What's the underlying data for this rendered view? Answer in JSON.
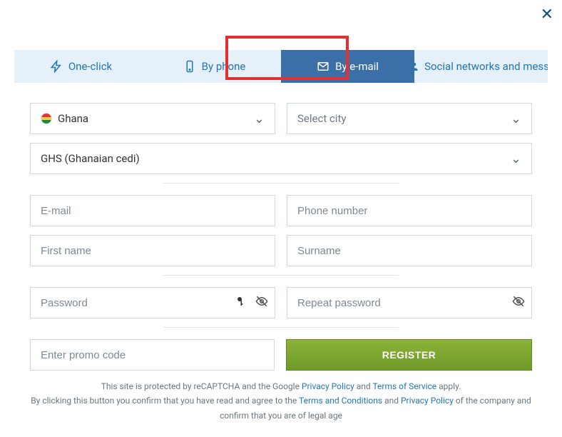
{
  "close": "✕",
  "tabs": {
    "one_click": "One-click",
    "by_phone": "By phone",
    "by_email": "By e-mail",
    "social": "Social networks and mess…"
  },
  "form": {
    "country_label": "Ghana",
    "city_placeholder": "Select city",
    "currency_label": "GHS (Ghanaian cedi)",
    "email_placeholder": "E-mail",
    "phone_placeholder": "Phone number",
    "first_name_placeholder": "First name",
    "surname_placeholder": "Surname",
    "password_placeholder": "Password",
    "repeat_password_placeholder": "Repeat password",
    "promo_placeholder": "Enter promo code",
    "register_label": "REGISTER"
  },
  "legal": {
    "recaptcha_prefix": "This site is protected by reCAPTCHA and the Google ",
    "privacy_policy": "Privacy Policy",
    "and": " and ",
    "terms_of_service": "Terms of Service",
    "apply": " apply.",
    "confirm_prefix": "By clicking this button you confirm that you have read and agree to the ",
    "terms_and_conditions": "Terms and Conditions",
    "privacy_policy2": "Privacy Policy",
    "confirm_suffix": " of the company and confirm that you are of legal age"
  }
}
